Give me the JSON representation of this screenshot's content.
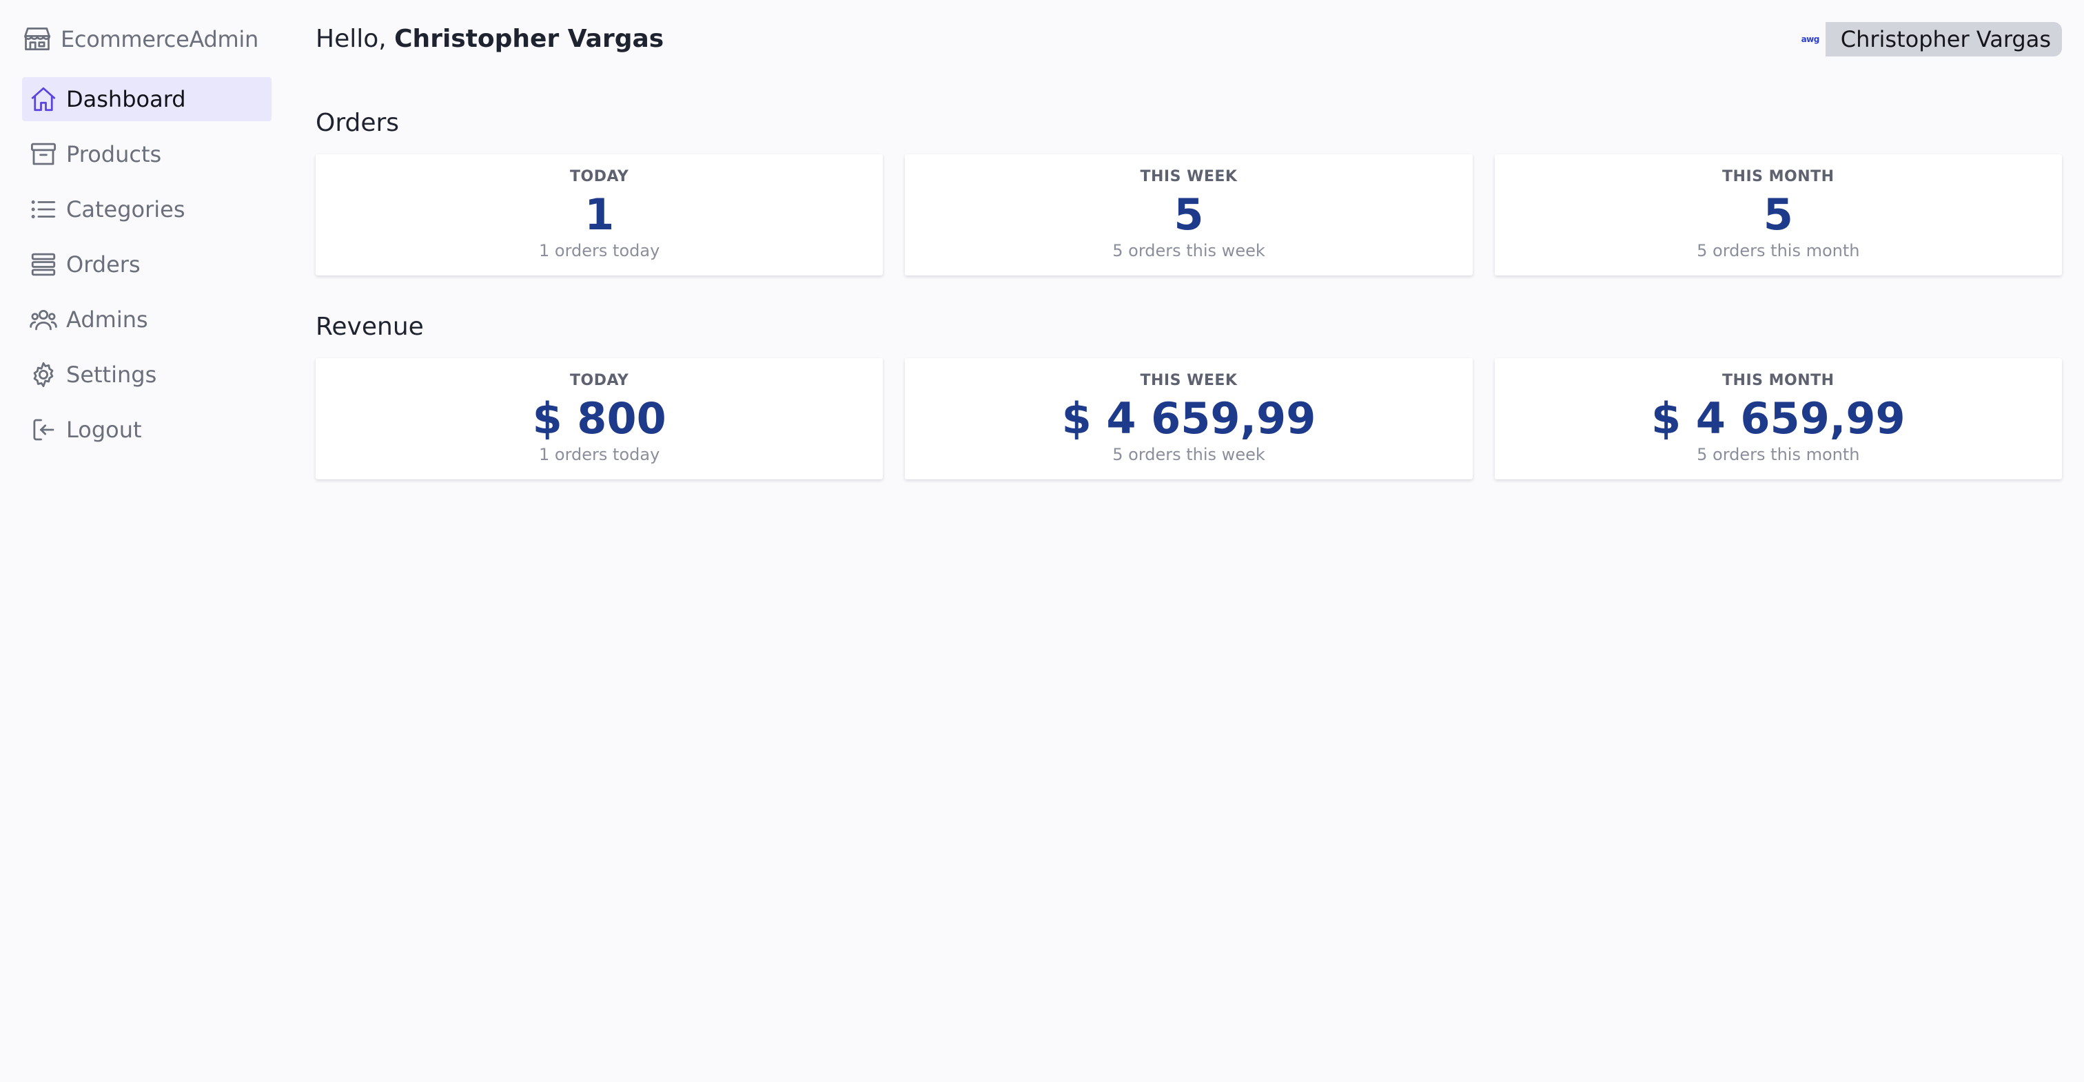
{
  "app": {
    "brand": "EcommerceAdmin"
  },
  "sidebar": {
    "items": [
      {
        "label": "Dashboard",
        "icon": "home-icon",
        "active": true
      },
      {
        "label": "Products",
        "icon": "archive-icon"
      },
      {
        "label": "Categories",
        "icon": "list-icon"
      },
      {
        "label": "Orders",
        "icon": "stack-icon"
      },
      {
        "label": "Admins",
        "icon": "users-icon"
      },
      {
        "label": "Settings",
        "icon": "gear-icon"
      },
      {
        "label": "Logout",
        "icon": "logout-icon"
      }
    ]
  },
  "header": {
    "greeting_prefix": "Hello, ",
    "user_name": "Christopher Vargas",
    "user_logo_text": "awg"
  },
  "orders": {
    "title": "Orders",
    "cards": [
      {
        "label": "TODAY",
        "value": "1",
        "sub": "1 orders today"
      },
      {
        "label": "THIS WEEK",
        "value": "5",
        "sub": "5 orders this week"
      },
      {
        "label": "THIS MONTH",
        "value": "5",
        "sub": "5 orders this month"
      }
    ]
  },
  "revenue": {
    "title": "Revenue",
    "cards": [
      {
        "label": "TODAY",
        "value": "$ 800",
        "sub": "1 orders today"
      },
      {
        "label": "THIS WEEK",
        "value": "$ 4 659,99",
        "sub": "5 orders this week"
      },
      {
        "label": "THIS MONTH",
        "value": "$ 4 659,99",
        "sub": "5 orders this month"
      }
    ]
  },
  "colors": {
    "accent": "#5a44e0",
    "active_bg": "#e9e7fb",
    "value": "#1e3a8a"
  }
}
